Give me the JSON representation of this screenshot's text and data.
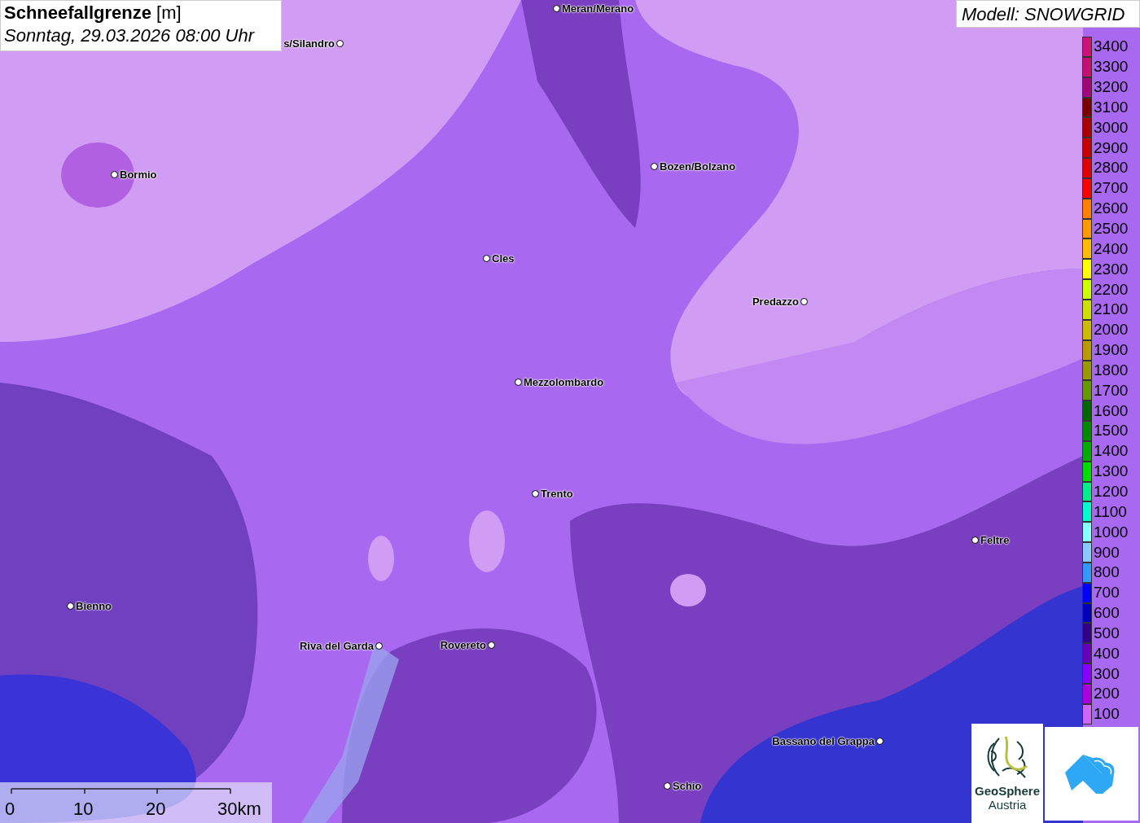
{
  "title": {
    "name": "Schneefallgrenze",
    "unit": "[m]",
    "time": "Sonntag, 29.03.2026 08:00 Uhr"
  },
  "model": "Modell: SNOWGRID",
  "cities": [
    {
      "name": "Meran/Merano"
    },
    {
      "name": "s/Silandro"
    },
    {
      "name": "Bormio"
    },
    {
      "name": "Bozen/Bolzano"
    },
    {
      "name": "Cles"
    },
    {
      "name": "Predazzo"
    },
    {
      "name": "Mezzolombardo"
    },
    {
      "name": "Trento"
    },
    {
      "name": "Feltre"
    },
    {
      "name": "Bienno"
    },
    {
      "name": "Riva del Garda"
    },
    {
      "name": "Rovereto"
    },
    {
      "name": "Bassano del Grappa"
    },
    {
      "name": "Schio"
    }
  ],
  "legend": [
    {
      "label": "3400",
      "color": "#cc1477"
    },
    {
      "label": "3300",
      "color": "#c4106e"
    },
    {
      "label": "3200",
      "color": "#a0087a"
    },
    {
      "label": "3100",
      "color": "#7a0000"
    },
    {
      "label": "3000",
      "color": "#aa0000"
    },
    {
      "label": "2900",
      "color": "#c80000"
    },
    {
      "label": "2800",
      "color": "#e00000"
    },
    {
      "label": "2700",
      "color": "#ff0000"
    },
    {
      "label": "2600",
      "color": "#ff8000"
    },
    {
      "label": "2500",
      "color": "#ff9900"
    },
    {
      "label": "2400",
      "color": "#ffbb00"
    },
    {
      "label": "2300",
      "color": "#ffff00"
    },
    {
      "label": "2200",
      "color": "#ccff00"
    },
    {
      "label": "2100",
      "color": "#cce000"
    },
    {
      "label": "2000",
      "color": "#ccbb00"
    },
    {
      "label": "1900",
      "color": "#bb9900"
    },
    {
      "label": "1800",
      "color": "#999900"
    },
    {
      "label": "1700",
      "color": "#669900"
    },
    {
      "label": "1600",
      "color": "#006600"
    },
    {
      "label": "1500",
      "color": "#008800"
    },
    {
      "label": "1400",
      "color": "#00aa00"
    },
    {
      "label": "1300",
      "color": "#00dd00"
    },
    {
      "label": "1200",
      "color": "#00ee88"
    },
    {
      "label": "1100",
      "color": "#00ffcc"
    },
    {
      "label": "1000",
      "color": "#88ffff"
    },
    {
      "label": "900",
      "color": "#88ccff"
    },
    {
      "label": "800",
      "color": "#3399ff"
    },
    {
      "label": "700",
      "color": "#0000ff"
    },
    {
      "label": "600",
      "color": "#0000bb"
    },
    {
      "label": "500",
      "color": "#330088"
    },
    {
      "label": "400",
      "color": "#6600bb"
    },
    {
      "label": "300",
      "color": "#8800ff"
    },
    {
      "label": "200",
      "color": "#aa00dd"
    },
    {
      "label": "100",
      "color": "#cc66ff"
    }
  ],
  "scale": [
    "0",
    "10",
    "20",
    "30km"
  ],
  "logo": {
    "line1": "GeoSphere",
    "line2": "Austria"
  }
}
